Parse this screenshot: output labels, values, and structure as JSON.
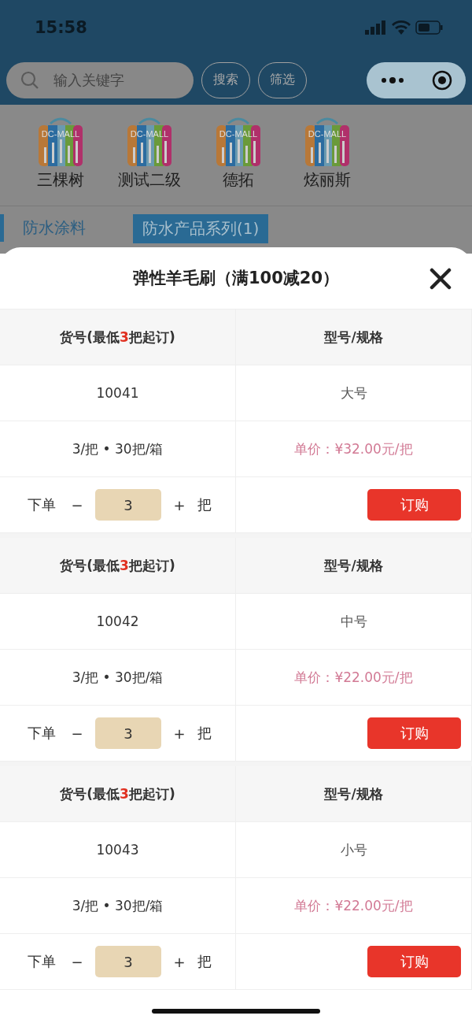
{
  "status_bar": {
    "time": "15:58"
  },
  "nav": {
    "search": {
      "placeholder": "输入关键字"
    },
    "buttons": [
      "搜索",
      "筛选"
    ]
  },
  "brands": [
    {
      "name": "三棵树",
      "logo_text": "DC-MALL"
    },
    {
      "name": "测试二级",
      "logo_text": "DC-MALL"
    },
    {
      "name": "德拓",
      "logo_text": "DC-MALL"
    },
    {
      "name": "炫丽斯",
      "logo_text": "DC-MALL"
    }
  ],
  "category": {
    "label": "防水涂料"
  },
  "subcategories": [
    {
      "label": "防水产品系列(1)",
      "selected": true
    }
  ],
  "sheet": {
    "title": "弹性羊毛刷（满100减20）",
    "products": [
      {
        "code_header": {
          "before": "货号(最低",
          "highlight": "3",
          "after": "把起订)"
        },
        "spec_header": "型号/规格",
        "code": "10041",
        "size": "大号",
        "pack": "3/把 • 30把/箱",
        "price": "单价：¥32.00元/把",
        "order_label": "下单",
        "minus": "−",
        "quantity": "3",
        "plus": "+",
        "unit": "把",
        "buy": "订购"
      },
      {
        "code_header": {
          "before": "货号(最低",
          "highlight": "3",
          "after": "把起订)"
        },
        "spec_header": "型号/规格",
        "code": "10042",
        "size": "中号",
        "pack": "3/把 • 30把/箱",
        "price": "单价：¥22.00元/把",
        "order_label": "下单",
        "minus": "−",
        "quantity": "3",
        "plus": "+",
        "unit": "把",
        "buy": "订购"
      },
      {
        "code_header": {
          "before": "货号(最低",
          "highlight": "3",
          "after": "把起订)"
        },
        "spec_header": "型号/规格",
        "code": "10043",
        "size": "小号",
        "pack": "3/把 • 30把/箱",
        "price": "单价：¥22.00元/把",
        "order_label": "下单",
        "minus": "−",
        "quantity": "3",
        "plus": "+",
        "unit": "把",
        "buy": "订购"
      }
    ]
  }
}
